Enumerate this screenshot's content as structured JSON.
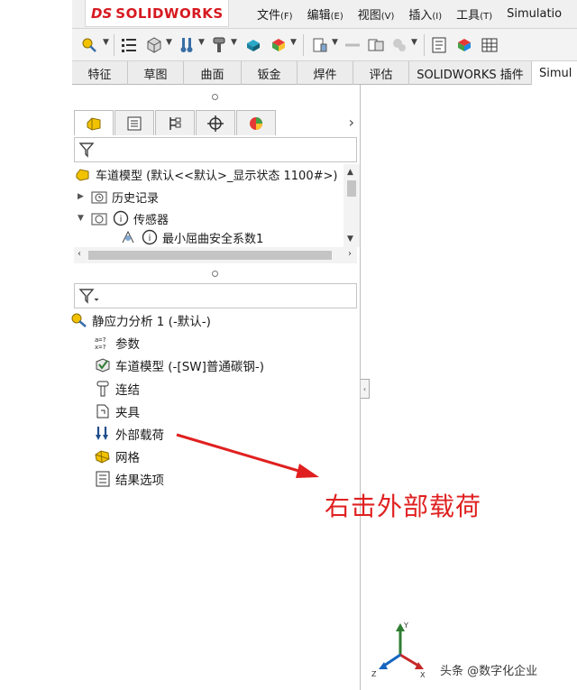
{
  "app": {
    "logo_prefix": "DS",
    "logo_text": "SOLIDWORKS"
  },
  "menu": [
    {
      "label": "文件",
      "accel": "(F)"
    },
    {
      "label": "编辑",
      "accel": "(E)"
    },
    {
      "label": "视图",
      "accel": "(V)"
    },
    {
      "label": "插入",
      "accel": "(I)"
    },
    {
      "label": "工具",
      "accel": "(T)"
    },
    {
      "label": "Simulatio",
      "accel": ""
    }
  ],
  "toolbar_icons": [
    "wizard-icon",
    "list-icon",
    "cube-icon",
    "thermometer-load-icon",
    "fixture-icon",
    "mesh-icon",
    "run-study-icon",
    "result-icon",
    "plot-icon",
    "compare-icon",
    "probe-icon",
    "report-icon",
    "settings-icon"
  ],
  "command_tabs": [
    "特征",
    "草图",
    "曲面",
    "钣金",
    "焊件",
    "评估",
    "SOLIDWORKS 插件",
    "Simul"
  ],
  "feature_tree": {
    "root": "车道模型 (默认<<默认>_显示状态 1100#>)",
    "items": [
      {
        "label": "历史记录",
        "expander": "▶"
      },
      {
        "label": "传感器",
        "expander": "▼"
      },
      {
        "label": "最小屈曲安全系数1",
        "expander": ""
      }
    ]
  },
  "simulation_tree": {
    "root": "静应力分析 1 (-默认-)",
    "items": [
      {
        "label": "参数",
        "icon": "parameters-icon"
      },
      {
        "label": "车道模型 (-[SW]普通碳钢-)",
        "icon": "part-material-icon"
      },
      {
        "label": "连结",
        "icon": "connections-icon"
      },
      {
        "label": "夹具",
        "icon": "fixtures-icon"
      },
      {
        "label": "外部载荷",
        "icon": "external-loads-icon"
      },
      {
        "label": "网格",
        "icon": "mesh-icon"
      },
      {
        "label": "结果选项",
        "icon": "result-options-icon"
      }
    ]
  },
  "annotation": "右击外部载荷",
  "watermark": "头条 @数字化企业",
  "colors": {
    "brand_red": "#d71920",
    "annotation_red": "#e02020"
  }
}
